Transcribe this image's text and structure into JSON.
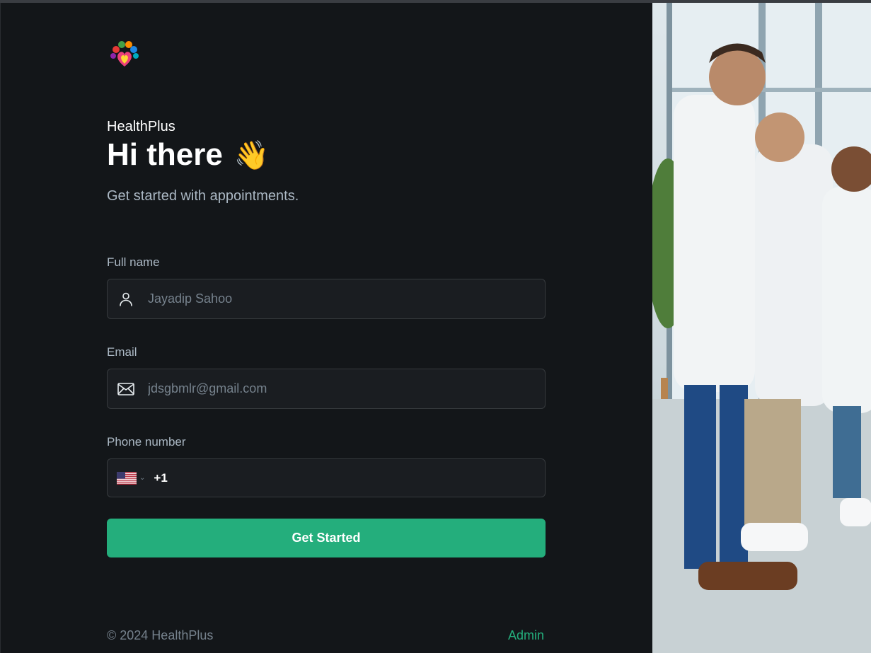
{
  "brand": "HealthPlus",
  "title": "Hi there",
  "title_emoji": "👋",
  "subtitle": "Get started with appointments.",
  "form": {
    "full_name": {
      "label": "Full name",
      "placeholder": "Jayadip Sahoo",
      "icon": "user-icon"
    },
    "email": {
      "label": "Email",
      "placeholder": "jdsgbmlr@gmail.com",
      "icon": "mail-icon"
    },
    "phone": {
      "label": "Phone number",
      "country": "US",
      "dial_code": "+1",
      "value": ""
    }
  },
  "submit_label": "Get Started",
  "footer": {
    "copyright": "© 2024 HealthPlus",
    "admin_link": "Admin"
  },
  "colors": {
    "background": "#131619",
    "accent": "#24ae7c",
    "input_bg": "#1a1d21",
    "input_border": "#363a3d",
    "muted": "#abb8c4"
  }
}
